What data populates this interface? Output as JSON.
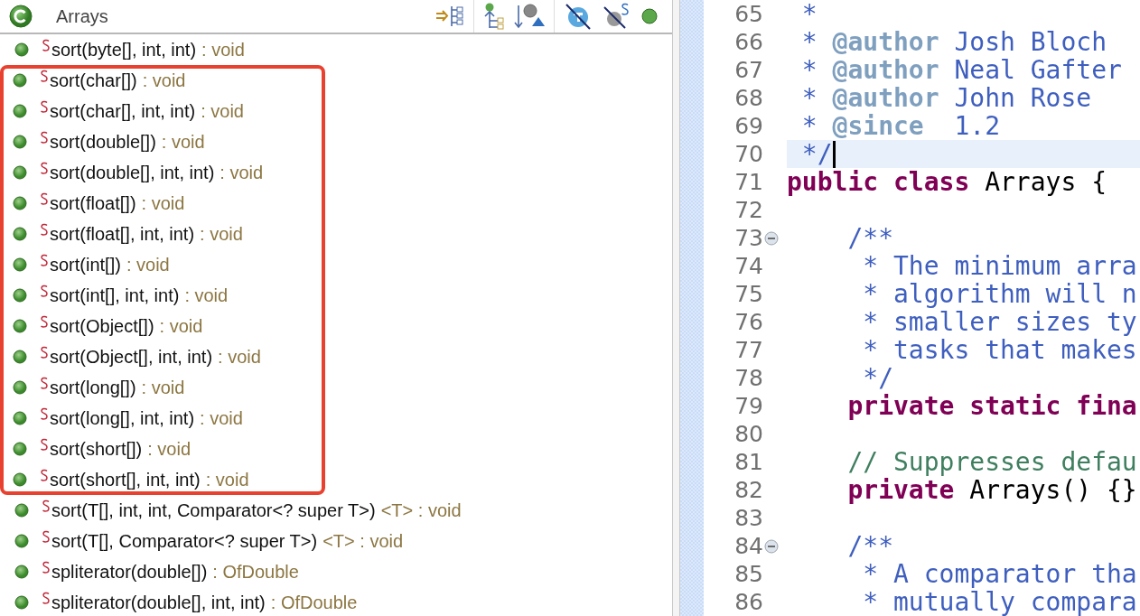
{
  "outline": {
    "title": "Arrays",
    "groups": [
      {
        "framed": false,
        "items": [
          {
            "name": "sort(byte[], int, int)",
            "type": ": void"
          }
        ]
      },
      {
        "framed": true,
        "items": [
          {
            "name": "sort(char[])",
            "type": ": void"
          },
          {
            "name": "sort(char[], int, int)",
            "type": ": void"
          },
          {
            "name": "sort(double[])",
            "type": ": void"
          },
          {
            "name": "sort(double[], int, int)",
            "type": ": void"
          },
          {
            "name": "sort(float[])",
            "type": ": void"
          },
          {
            "name": "sort(float[], int, int)",
            "type": ": void"
          },
          {
            "name": "sort(int[])",
            "type": ": void"
          },
          {
            "name": "sort(int[], int, int)",
            "type": ": void"
          },
          {
            "name": "sort(Object[])",
            "type": ": void"
          },
          {
            "name": "sort(Object[], int, int)",
            "type": ": void"
          },
          {
            "name": "sort(long[])",
            "type": ": void"
          },
          {
            "name": "sort(long[], int, int)",
            "type": ": void"
          },
          {
            "name": "sort(short[])",
            "type": ": void"
          },
          {
            "name": "sort(short[], int, int)",
            "type": ": void"
          }
        ]
      },
      {
        "framed": false,
        "items": [
          {
            "name": "sort(T[], int, int, Comparator<? super T>)",
            "type": "<T> : void"
          },
          {
            "name": "sort(T[], Comparator<? super T>)",
            "type": "<T> : void"
          },
          {
            "name": "spliterator(double[])",
            "type": ": OfDouble"
          },
          {
            "name": "spliterator(double[], int, int)",
            "type": ": OfDouble"
          }
        ]
      }
    ]
  },
  "editor": {
    "lines": [
      {
        "number": "65",
        "fold": false,
        "current": false,
        "tokens": [
          {
            "kind": "doc",
            "text": " *"
          }
        ]
      },
      {
        "number": "66",
        "fold": false,
        "current": false,
        "tokens": [
          {
            "kind": "doc",
            "text": " * "
          },
          {
            "kind": "doctag",
            "text": "@author"
          },
          {
            "kind": "doc",
            "text": " Josh Bloch"
          }
        ]
      },
      {
        "number": "67",
        "fold": false,
        "current": false,
        "tokens": [
          {
            "kind": "doc",
            "text": " * "
          },
          {
            "kind": "doctag",
            "text": "@author"
          },
          {
            "kind": "doc",
            "text": " Neal Gafter"
          }
        ]
      },
      {
        "number": "68",
        "fold": false,
        "current": false,
        "tokens": [
          {
            "kind": "doc",
            "text": " * "
          },
          {
            "kind": "doctag",
            "text": "@author"
          },
          {
            "kind": "doc",
            "text": " John Rose"
          }
        ]
      },
      {
        "number": "69",
        "fold": false,
        "current": false,
        "tokens": [
          {
            "kind": "doc",
            "text": " * "
          },
          {
            "kind": "doctag",
            "text": "@since"
          },
          {
            "kind": "doc",
            "text": "  1.2"
          }
        ]
      },
      {
        "number": "70",
        "fold": false,
        "current": true,
        "tokens": [
          {
            "kind": "doc",
            "text": " */"
          }
        ]
      },
      {
        "number": "71",
        "fold": false,
        "current": false,
        "tokens": [
          {
            "kind": "keyword",
            "text": "public class"
          },
          {
            "kind": "plain",
            "text": " Arrays {"
          }
        ]
      },
      {
        "number": "72",
        "fold": false,
        "current": false
      },
      {
        "number": "73",
        "fold": true,
        "current": false,
        "tokens": [
          {
            "kind": "doc",
            "text": "    /**"
          }
        ]
      },
      {
        "number": "74",
        "fold": false,
        "current": false,
        "tokens": [
          {
            "kind": "doc",
            "text": "     * The minimum arra"
          }
        ]
      },
      {
        "number": "75",
        "fold": false,
        "current": false,
        "tokens": [
          {
            "kind": "doc",
            "text": "     * algorithm will n"
          }
        ]
      },
      {
        "number": "76",
        "fold": false,
        "current": false,
        "tokens": [
          {
            "kind": "doc",
            "text": "     * smaller sizes ty"
          }
        ]
      },
      {
        "number": "77",
        "fold": false,
        "current": false,
        "tokens": [
          {
            "kind": "doc",
            "text": "     * tasks that makes"
          }
        ]
      },
      {
        "number": "78",
        "fold": false,
        "current": false,
        "tokens": [
          {
            "kind": "doc",
            "text": "     */"
          }
        ]
      },
      {
        "number": "79",
        "fold": false,
        "current": false,
        "tokens": [
          {
            "kind": "keyword",
            "text": "    private static fina"
          }
        ]
      },
      {
        "number": "80",
        "fold": false,
        "current": false
      },
      {
        "number": "81",
        "fold": false,
        "current": false,
        "tokens": [
          {
            "kind": "comment",
            "text": "    // Suppresses defau"
          }
        ]
      },
      {
        "number": "82",
        "fold": false,
        "current": false,
        "tokens": [
          {
            "kind": "keyword",
            "text": "    private"
          },
          {
            "kind": "plain",
            "text": " Arrays() {}"
          }
        ]
      },
      {
        "number": "83",
        "fold": false,
        "current": false
      },
      {
        "number": "84",
        "fold": true,
        "current": false,
        "tokens": [
          {
            "kind": "doc",
            "text": "    /**"
          }
        ]
      },
      {
        "number": "85",
        "fold": false,
        "current": false,
        "tokens": [
          {
            "kind": "doc",
            "text": "     * A comparator tha"
          }
        ]
      },
      {
        "number": "86",
        "fold": false,
        "current": false,
        "tokens": [
          {
            "kind": "doc",
            "text": "     * mutually compara"
          }
        ]
      }
    ]
  }
}
